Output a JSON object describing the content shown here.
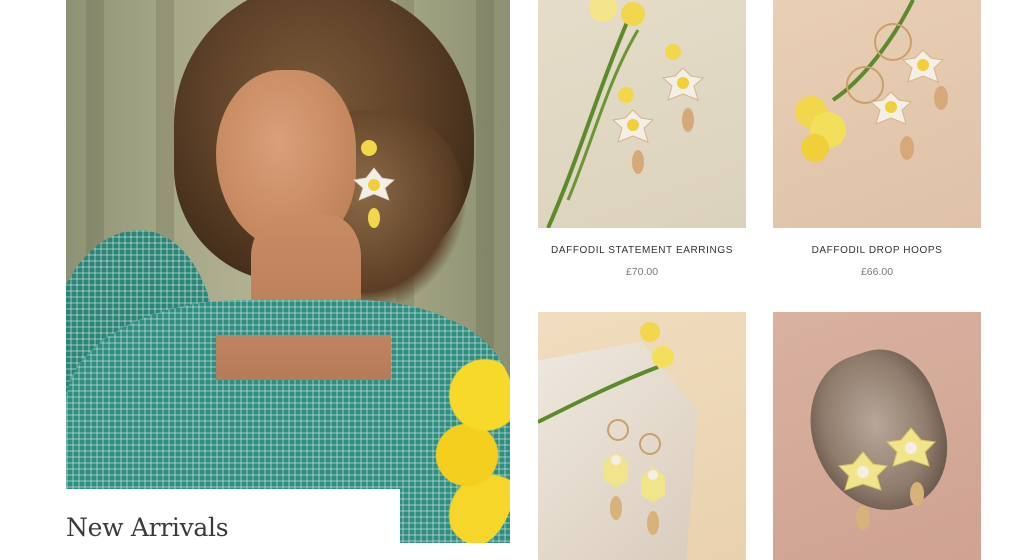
{
  "hero": {
    "caption": "New Arrivals",
    "image_desc": "Model with curly hair wearing teal gingham blouse and daffodil statement earring"
  },
  "products": [
    {
      "name": "DAFFODIL STATEMENT EARRINGS",
      "price": "£70.00"
    },
    {
      "name": "DAFFODIL DROP HOOPS",
      "price": "£66.00"
    },
    {
      "name": "",
      "price": ""
    },
    {
      "name": "",
      "price": ""
    }
  ],
  "colors": {
    "petal": "#f3efe6",
    "daffodil_yellow": "#f2d64b",
    "gold": "#d7b27a",
    "stem_green": "#5e8a2e",
    "text": "#333333",
    "price": "#7a7a7a"
  }
}
